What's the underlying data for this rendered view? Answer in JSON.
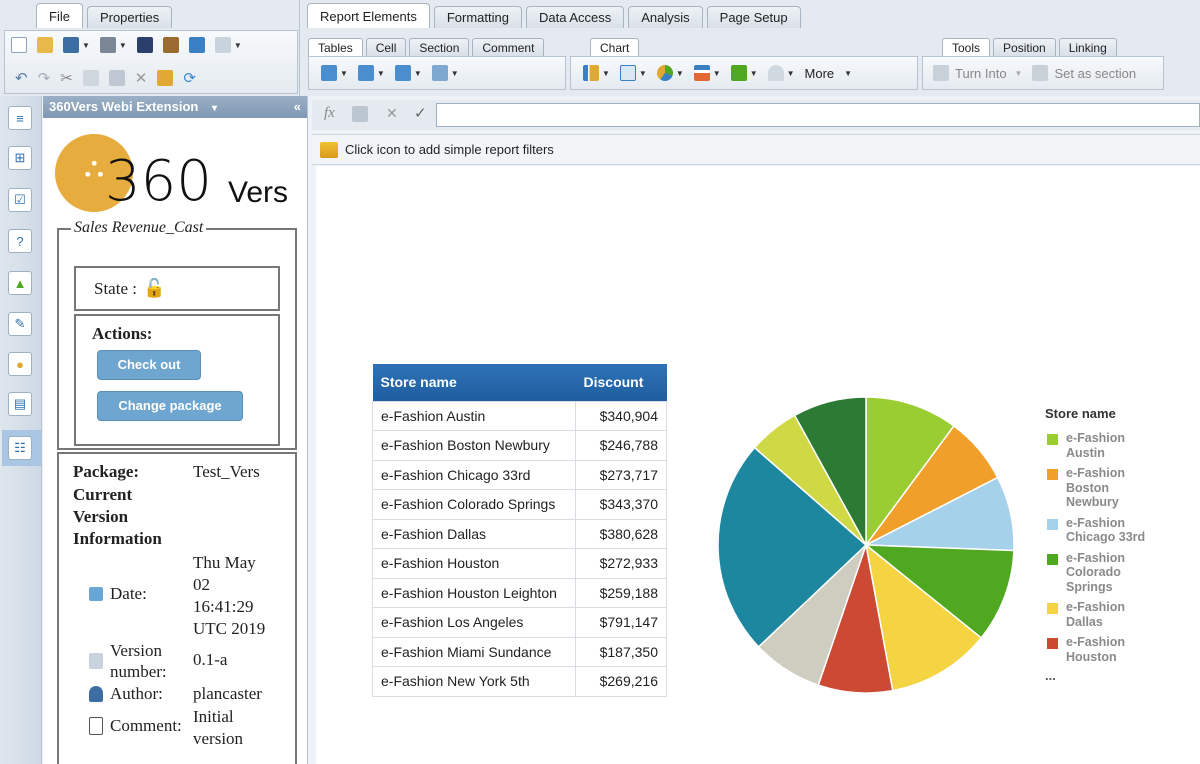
{
  "top_tabs_left": [
    "File",
    "Properties"
  ],
  "top_tabs_right": [
    "Report Elements",
    "Formatting",
    "Data Access",
    "Analysis",
    "Page Setup"
  ],
  "sub_groups": {
    "tables": [
      "Tables",
      "Cell",
      "Section",
      "Comment"
    ],
    "chart": [
      "Chart"
    ],
    "tools": [
      "Tools",
      "Position",
      "Linking"
    ]
  },
  "ribbon": {
    "more_label": "More",
    "turn_into_label": "Turn Into",
    "set_as_section_label": "Set as section"
  },
  "formula_bar": {
    "fx": "fx"
  },
  "filter_bar": {
    "text": "Click icon to add simple report filters"
  },
  "panel": {
    "title": "360Vers Webi Extension",
    "logo_number": "360",
    "logo_word": "Vers",
    "document_name": "Sales Revenue_Cast",
    "state_label": "State :",
    "actions_label": "Actions:",
    "checkout_label": "Check out",
    "change_package_label": "Change package",
    "package_label": "Package:",
    "package_value": "Test_Vers",
    "version_info_title_1": "Current",
    "version_info_title_2": "Version",
    "version_info_title_3": "Information",
    "date_label": "Date:",
    "date_value_1": "Thu May",
    "date_value_2": "02",
    "date_value_3": "16:41:29",
    "date_value_4": "UTC 2019",
    "version_label_1": "Version",
    "version_label_2": "number:",
    "version_value": "0.1-a",
    "author_label": "Author:",
    "author_value": "plancaster",
    "comment_label": "Comment:",
    "comment_value_1": "Initial",
    "comment_value_2": "version"
  },
  "table": {
    "headers": [
      "Store name",
      "Discount"
    ],
    "rows": [
      [
        "e-Fashion Austin",
        "$340,904"
      ],
      [
        "e-Fashion Boston Newbury",
        "$246,788"
      ],
      [
        "e-Fashion Chicago 33rd",
        "$273,717"
      ],
      [
        "e-Fashion Colorado Springs",
        "$343,370"
      ],
      [
        "e-Fashion Dallas",
        "$380,628"
      ],
      [
        "e-Fashion Houston",
        "$272,933"
      ],
      [
        "e-Fashion Houston Leighton",
        "$259,188"
      ],
      [
        "e-Fashion Los Angeles",
        "$791,147"
      ],
      [
        "e-Fashion Miami Sundance",
        "$187,350"
      ],
      [
        "e-Fashion New York 5th",
        "$269,216"
      ]
    ]
  },
  "pie": {
    "legend_title": "Store name",
    "legend_more": "...",
    "slices": [
      {
        "value": 340904,
        "color": "#9acd32"
      },
      {
        "value": 246788,
        "color": "#f0a02a"
      },
      {
        "value": 273717,
        "color": "#a6d1ea"
      },
      {
        "value": 343370,
        "color": "#4fa820"
      },
      {
        "value": 380628,
        "color": "#f4d442"
      },
      {
        "value": 272933,
        "color": "#cc4a33"
      },
      {
        "value": 259188,
        "color": "#cfccc0"
      },
      {
        "value": 791147,
        "color": "#1e87a0"
      },
      {
        "value": 187350,
        "color": "#cfd845"
      },
      {
        "value": 269216,
        "color": "#2c7a34"
      }
    ],
    "legend": [
      {
        "label": "e-Fashion Austin",
        "color": "#9acd32"
      },
      {
        "label": "e-Fashion Boston Newbury",
        "color": "#f0a02a"
      },
      {
        "label": "e-Fashion Chicago 33rd",
        "color": "#a6d1ea"
      },
      {
        "label": "e-Fashion Colorado Springs",
        "color": "#4fa820"
      },
      {
        "label": "e-Fashion Dallas",
        "color": "#f4d442"
      },
      {
        "label": "e-Fashion Houston",
        "color": "#cc4a33"
      }
    ]
  }
}
